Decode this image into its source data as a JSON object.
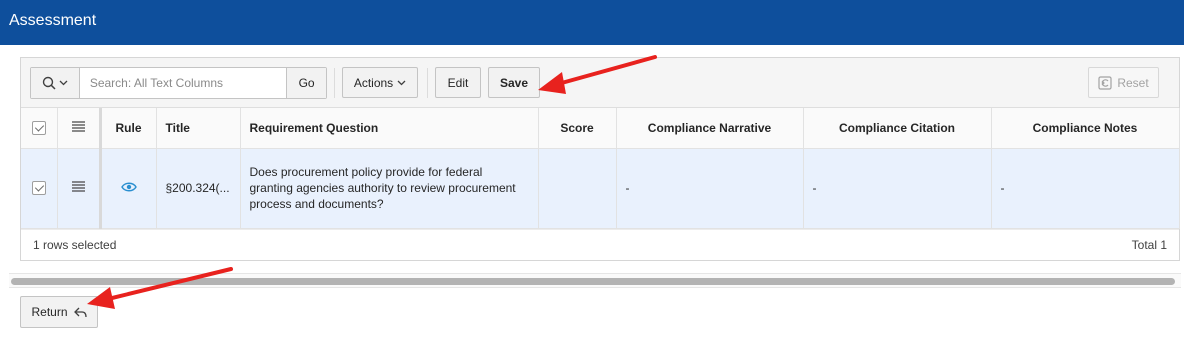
{
  "header": {
    "title": "Assessment"
  },
  "toolbar": {
    "search_placeholder": "Search: All Text Columns",
    "go_label": "Go",
    "actions_label": "Actions",
    "edit_label": "Edit",
    "save_label": "Save",
    "reset_label": "Reset"
  },
  "grid": {
    "columns": {
      "rule": "Rule",
      "title": "Title",
      "question": "Requirement Question",
      "score": "Score",
      "narrative": "Compliance Narrative",
      "citation": "Compliance Citation",
      "notes": "Compliance Notes"
    },
    "rows": [
      {
        "selected": true,
        "title": "§200.324(...",
        "question": "Does procurement policy provide for federal granting agencies authority to review procurement process and documents?",
        "score": "",
        "narrative": "-",
        "citation": "-",
        "notes": "-"
      }
    ],
    "footer": {
      "selection": "1 rows selected",
      "total": "Total 1"
    }
  },
  "page": {
    "return_label": "Return"
  },
  "colors": {
    "header_bg": "#0e4f9c",
    "selected_row_bg": "#e9f1fd",
    "annotation_arrow": "#e8221e"
  },
  "icons": [
    "search-icon",
    "chevron-down-icon",
    "reset-icon",
    "checkbox-icon",
    "row-actions-icon",
    "view-rule-icon",
    "return-icon"
  ]
}
